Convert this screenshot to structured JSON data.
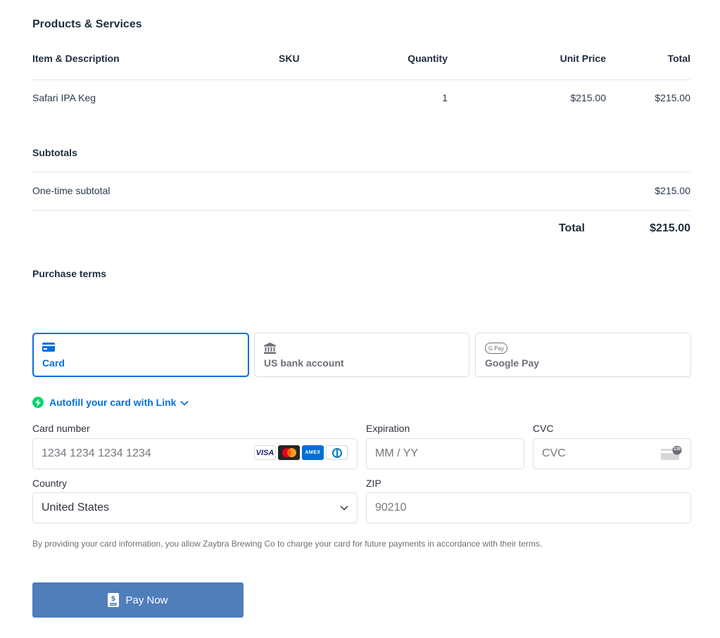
{
  "products": {
    "heading": "Products & Services",
    "columns": {
      "item": "Item & Description",
      "sku": "SKU",
      "quantity": "Quantity",
      "unit_price": "Unit Price",
      "total": "Total"
    },
    "rows": [
      {
        "item": "Safari IPA Keg",
        "sku": "",
        "quantity": "1",
        "unit_price": "$215.00",
        "total": "$215.00"
      }
    ]
  },
  "subtotals": {
    "heading": "Subtotals",
    "one_time_label": "One-time subtotal",
    "one_time_value": "$215.00",
    "total_label": "Total",
    "total_value": "$215.00"
  },
  "purchase_terms": {
    "heading": "Purchase terms"
  },
  "payment_tabs": [
    {
      "label": "Card",
      "icon": "credit-card-icon",
      "active": true
    },
    {
      "label": "US bank account",
      "icon": "bank-icon",
      "active": false
    },
    {
      "label": "Google Pay",
      "icon": "google-pay-icon",
      "active": false
    }
  ],
  "google_pay_badge": "G Pay",
  "autofill": {
    "label": "Autofill your card with Link"
  },
  "form": {
    "card_number_label": "Card number",
    "card_number_placeholder": "1234 1234 1234 1234",
    "expiration_label": "Expiration",
    "expiration_placeholder": "MM / YY",
    "cvc_label": "CVC",
    "cvc_placeholder": "CVC",
    "cvc_badge": "135",
    "country_label": "Country",
    "country_value": "United States",
    "zip_label": "ZIP",
    "zip_placeholder": "90210",
    "card_brands": [
      {
        "name": "VISA",
        "icon": "visa-icon"
      },
      {
        "name": "Mastercard",
        "icon": "mastercard-icon"
      },
      {
        "name": "AMEX",
        "icon": "amex-icon"
      },
      {
        "name": "Diners Club",
        "icon": "diners-icon"
      }
    ]
  },
  "consent_text": "By providing your card information, you allow Zaybra Brewing Co to charge your card for future payments in accordance with their terms.",
  "pay_button": {
    "label": "Pay Now",
    "icon": "receipt-icon"
  },
  "colors": {
    "accent": "#0570de",
    "pay_button": "#4f7ebb",
    "link_green": "#00d66f",
    "text": "#1f2d3d",
    "border": "#e0e0e0"
  }
}
